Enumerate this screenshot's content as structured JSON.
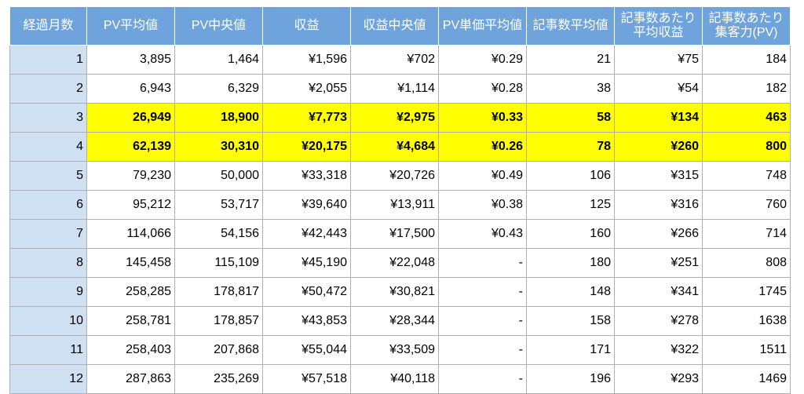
{
  "table": {
    "headers": [
      [
        "経過月数"
      ],
      [
        "PV平均値"
      ],
      [
        "PV中央値"
      ],
      [
        "収益"
      ],
      [
        "収益中央値"
      ],
      [
        "PV単価平均値"
      ],
      [
        "記事数平均値"
      ],
      [
        "記事数あたり",
        "平均収益"
      ],
      [
        "記事数あたり",
        "集客力(PV)"
      ]
    ],
    "rows": [
      {
        "cells": [
          "1",
          "3,895",
          "1,464",
          "¥1,596",
          "¥702",
          "¥0.29",
          "21",
          "¥75",
          "184"
        ],
        "highlight": false
      },
      {
        "cells": [
          "2",
          "6,943",
          "6,329",
          "¥2,055",
          "¥1,114",
          "¥0.28",
          "38",
          "¥54",
          "182"
        ],
        "highlight": false
      },
      {
        "cells": [
          "3",
          "26,949",
          "18,900",
          "¥7,773",
          "¥2,975",
          "¥0.33",
          "58",
          "¥134",
          "463"
        ],
        "highlight": true
      },
      {
        "cells": [
          "4",
          "62,139",
          "30,310",
          "¥20,175",
          "¥4,684",
          "¥0.26",
          "78",
          "¥260",
          "800"
        ],
        "highlight": true
      },
      {
        "cells": [
          "5",
          "79,230",
          "50,000",
          "¥33,318",
          "¥20,726",
          "¥0.49",
          "106",
          "¥315",
          "748"
        ],
        "highlight": false
      },
      {
        "cells": [
          "6",
          "95,212",
          "53,717",
          "¥39,640",
          "¥13,911",
          "¥0.38",
          "125",
          "¥316",
          "760"
        ],
        "highlight": false
      },
      {
        "cells": [
          "7",
          "114,066",
          "54,156",
          "¥42,443",
          "¥17,500",
          "¥0.43",
          "160",
          "¥266",
          "714"
        ],
        "highlight": false
      },
      {
        "cells": [
          "8",
          "145,458",
          "115,109",
          "¥45,190",
          "¥22,048",
          "-",
          "180",
          "¥251",
          "808"
        ],
        "highlight": false
      },
      {
        "cells": [
          "9",
          "258,285",
          "178,817",
          "¥50,472",
          "¥30,821",
          "-",
          "148",
          "¥341",
          "1745"
        ],
        "highlight": false
      },
      {
        "cells": [
          "10",
          "258,781",
          "178,857",
          "¥43,853",
          "¥28,344",
          "-",
          "158",
          "¥278",
          "1638"
        ],
        "highlight": false
      },
      {
        "cells": [
          "11",
          "258,403",
          "207,868",
          "¥55,044",
          "¥33,509",
          "-",
          "171",
          "¥322",
          "1511"
        ],
        "highlight": false
      },
      {
        "cells": [
          "12",
          "287,863",
          "235,269",
          "¥57,518",
          "¥40,118",
          "-",
          "196",
          "¥293",
          "1469"
        ],
        "highlight": false
      }
    ]
  },
  "colors": {
    "header_bg": "#6fa3dc",
    "month_col_bg": "#cfe0f3",
    "highlight_bg": "#ffff00"
  }
}
